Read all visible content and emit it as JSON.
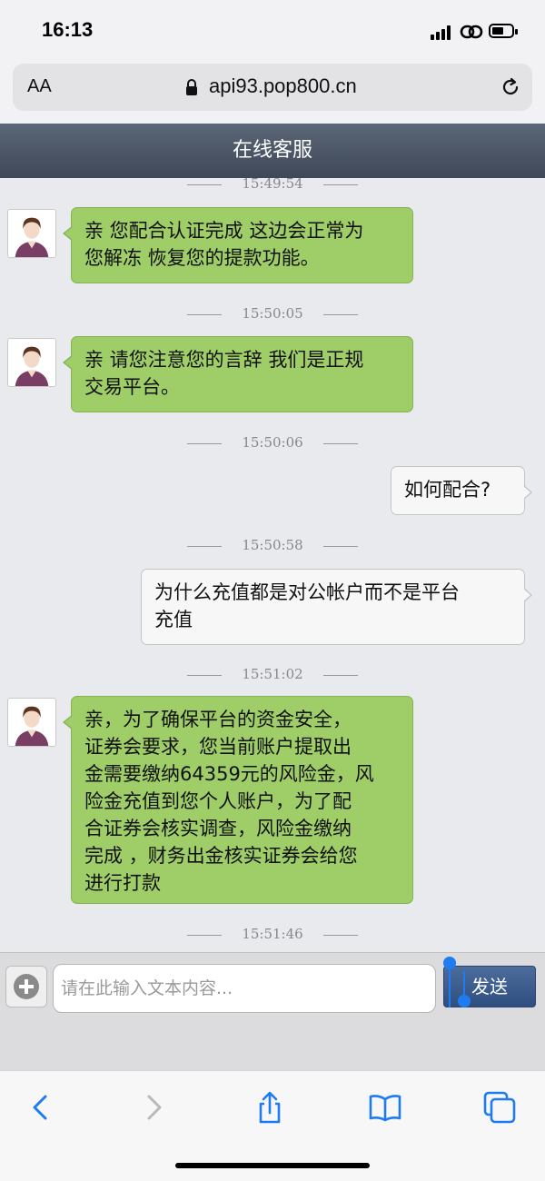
{
  "status_bar": {
    "time": "16:13"
  },
  "browser": {
    "font_size_label": "AA",
    "url": "api93.pop800.cn"
  },
  "chat": {
    "title": "在线客服",
    "timestamps": [
      "15:49:54",
      "15:50:05",
      "15:50:06",
      "15:50:58",
      "15:51:02",
      "15:51:46"
    ],
    "messages": [
      {
        "side": "agent",
        "lines": [
          "亲 您配合认证完成 这边会正常为",
          "您解冻 恢复您的提款功能。"
        ]
      },
      {
        "side": "agent",
        "lines": [
          "亲 请您注意您的言辞 我们是正规",
          "交易平台。"
        ]
      },
      {
        "side": "user",
        "lines": [
          "如何配合?"
        ]
      },
      {
        "side": "user",
        "lines": [
          "为什么充值都是对公帐户而不是平台",
          "充值"
        ]
      },
      {
        "side": "agent",
        "lines": [
          "亲，为了确保平台的资金安全，",
          "证券会要求，您当前账户提取出",
          "金需要缴纳64359元的风险金，风",
          "险金充值到您个人账户，为了配",
          "合证券会核实调查，风险金缴纳",
          "完成 ，财务出金核实证券会给您",
          "进行打款"
        ]
      }
    ]
  },
  "input": {
    "placeholder": "请在此输入文本内容...",
    "send_label": "发送"
  },
  "colors": {
    "agent_bubble": "#9fcd68",
    "user_bubble": "#f7f7f8",
    "header": "#4a5466",
    "send_button": "#3d5d8e",
    "ios_blue": "#1e7cf0"
  },
  "icons": [
    "signal-icon",
    "link-icon",
    "battery-icon",
    "lock-icon",
    "reload-icon",
    "plus-icon",
    "back-icon",
    "forward-icon",
    "share-icon",
    "bookmarks-icon",
    "tabs-icon"
  ]
}
